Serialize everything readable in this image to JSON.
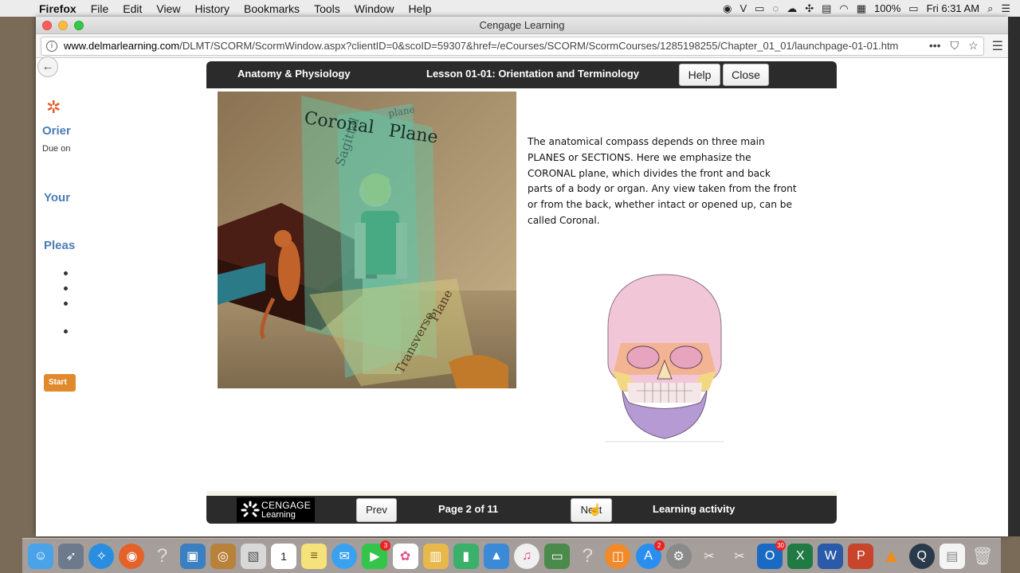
{
  "menubar": {
    "app_name": "Firefox",
    "items": [
      "File",
      "Edit",
      "View",
      "History",
      "Bookmarks",
      "Tools",
      "Window",
      "Help"
    ],
    "battery": "100%",
    "clock": "Fri 6:31 AM"
  },
  "browser": {
    "window_title": "Cengage Learning",
    "url_domain": "www.delmarlearning.com",
    "url_path": "/DLMT/SCORM/ScormWindow.aspx?clientID=0&scoID=59307&href=/eCourses/SCORM/ScormCourses/1285198255/Chapter_01_01/launchpage-01-01.htm",
    "url_more": "•••"
  },
  "lms": {
    "title": "Orier",
    "due": "Due on",
    "your": "Your",
    "please": "Pleas",
    "start": "Start"
  },
  "lesson": {
    "course_name": "Anatomy & Physiology",
    "lesson_name": "Lesson 01-01: Orientation and Terminology",
    "help_label": "Help",
    "close_label": "Close",
    "illustration": {
      "coronal": "Coronal",
      "plane": "Plane",
      "sagittal": "Sagittal",
      "plane_small": "plane",
      "transverse": "Transverse",
      "transverse_plane": "Plane"
    },
    "description": "The anatomical compass depends on three main PLANES or SECTIONS. Here we emphasize the CORONAL plane, which divides the front and back parts of a body or organ. Any view taken from the front or from the back, whether intact or opened up, can be called Coronal.",
    "footer": {
      "logo_line1": "CENGAGE",
      "logo_line2": "Learning",
      "prev_label": "Prev",
      "page_indicator": "Page 2 of 11",
      "next_label": "Next",
      "activity_label": "Learning activity"
    }
  },
  "dock": {
    "icons": [
      "finder",
      "launchpad",
      "safari",
      "firefox",
      "unknown",
      "preview",
      "contacts",
      "photo-viewer",
      "calendar",
      "notes",
      "messages",
      "facetime",
      "photos",
      "books-store",
      "numbers",
      "keynote",
      "itunes",
      "desktop-app",
      "unknown",
      "ibooks",
      "app-store",
      "system-preferences",
      "scissors-tool",
      "scissors-tool",
      "outlook",
      "excel",
      "word",
      "powerpoint",
      "vlc",
      "quicktime",
      "document",
      "trash"
    ],
    "badge_facetime": "3",
    "badge_appstore": "2",
    "badge_outlook": "30",
    "calendar_day": "1"
  }
}
